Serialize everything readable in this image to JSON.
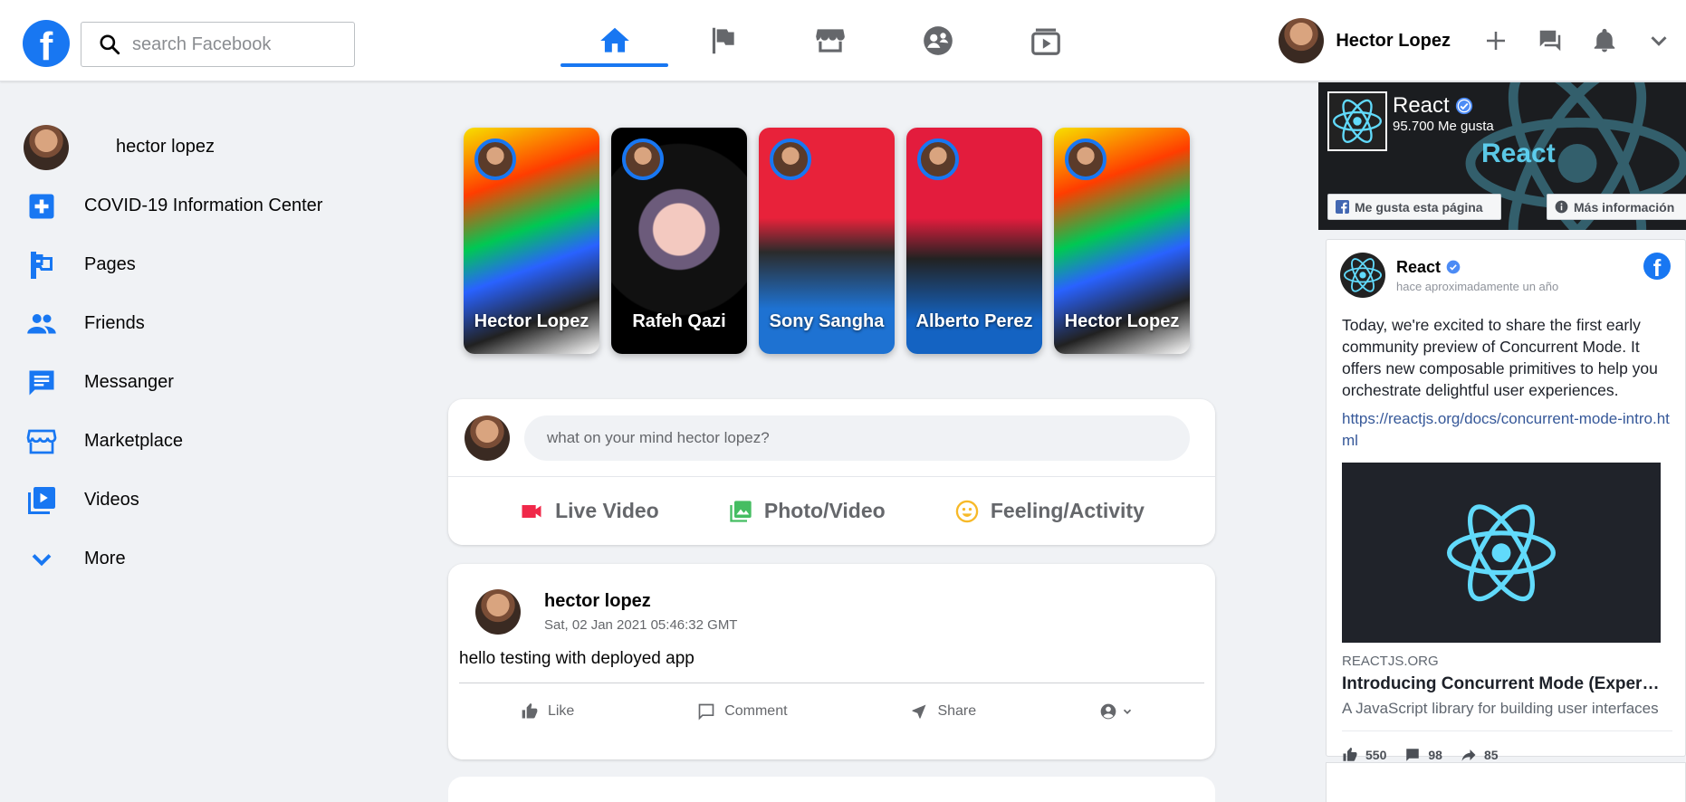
{
  "header": {
    "logo": "f",
    "search_placeholder": "search Facebook",
    "nav_tabs": [
      {
        "icon": "home-icon",
        "active": true
      },
      {
        "icon": "flag-icon",
        "active": false
      },
      {
        "icon": "storefront-icon",
        "active": false
      },
      {
        "icon": "groups-icon",
        "active": false
      },
      {
        "icon": "watch-icon",
        "active": false
      }
    ],
    "user_name": "Hector Lopez",
    "accent_color": "#1877f2"
  },
  "sidebar": {
    "user": "hector lopez",
    "items": [
      {
        "label": "COVID-19 Information Center",
        "icon": "local-hospital-icon"
      },
      {
        "label": "Pages",
        "icon": "emoji-flags-icon"
      },
      {
        "label": "Friends",
        "icon": "people-icon"
      },
      {
        "label": "Messanger",
        "icon": "chat-icon"
      },
      {
        "label": "Marketplace",
        "icon": "storefront-icon"
      },
      {
        "label": "Videos",
        "icon": "video-library-icon"
      },
      {
        "label": "More",
        "icon": "expand-more-icon"
      }
    ]
  },
  "stories": [
    {
      "name": "Hector Lopez"
    },
    {
      "name": "Rafeh Qazi"
    },
    {
      "name": "Sony Sangha"
    },
    {
      "name": "Alberto Perez"
    },
    {
      "name": "Hector Lopez"
    }
  ],
  "composer": {
    "placeholder": "what on your mind hector lopez?",
    "actions": [
      {
        "label": "Live Video",
        "icon": "videocam-icon",
        "color": "#f02849"
      },
      {
        "label": "Photo/Video",
        "icon": "photo-library-icon",
        "color": "#45bd62"
      },
      {
        "label": "Feeling/Activity",
        "icon": "emoji-icon",
        "color": "#f7b928"
      }
    ]
  },
  "post": {
    "author": "hector lopez",
    "timestamp": "Sat, 02 Jan 2021 05:46:32 GMT",
    "text": "hello testing with deployed app",
    "actions": [
      "Like",
      "Comment",
      "Share"
    ]
  },
  "page_plugin": {
    "name": "React",
    "likes": "95.700 Me gusta",
    "wordmark": "React",
    "like_button": "Me gusta esta página",
    "info_button": "Más información"
  },
  "embed": {
    "name": "React",
    "time": "hace aproximadamente un año",
    "text": "Today, we're excited to share the first early community preview of Concurrent Mode. It offers new composable primitives to help you orchestrate delightful user experiences.",
    "link": "https://reactjs.org/docs/concurrent-mode-intro.html",
    "source": "REACTJS.ORG",
    "headline": "Introducing Concurrent Mode (Experimental) – React",
    "description": "A JavaScript library for building user interfaces",
    "likes": "550",
    "comments": "98",
    "shares": "85",
    "react_color": "#61dafb"
  }
}
